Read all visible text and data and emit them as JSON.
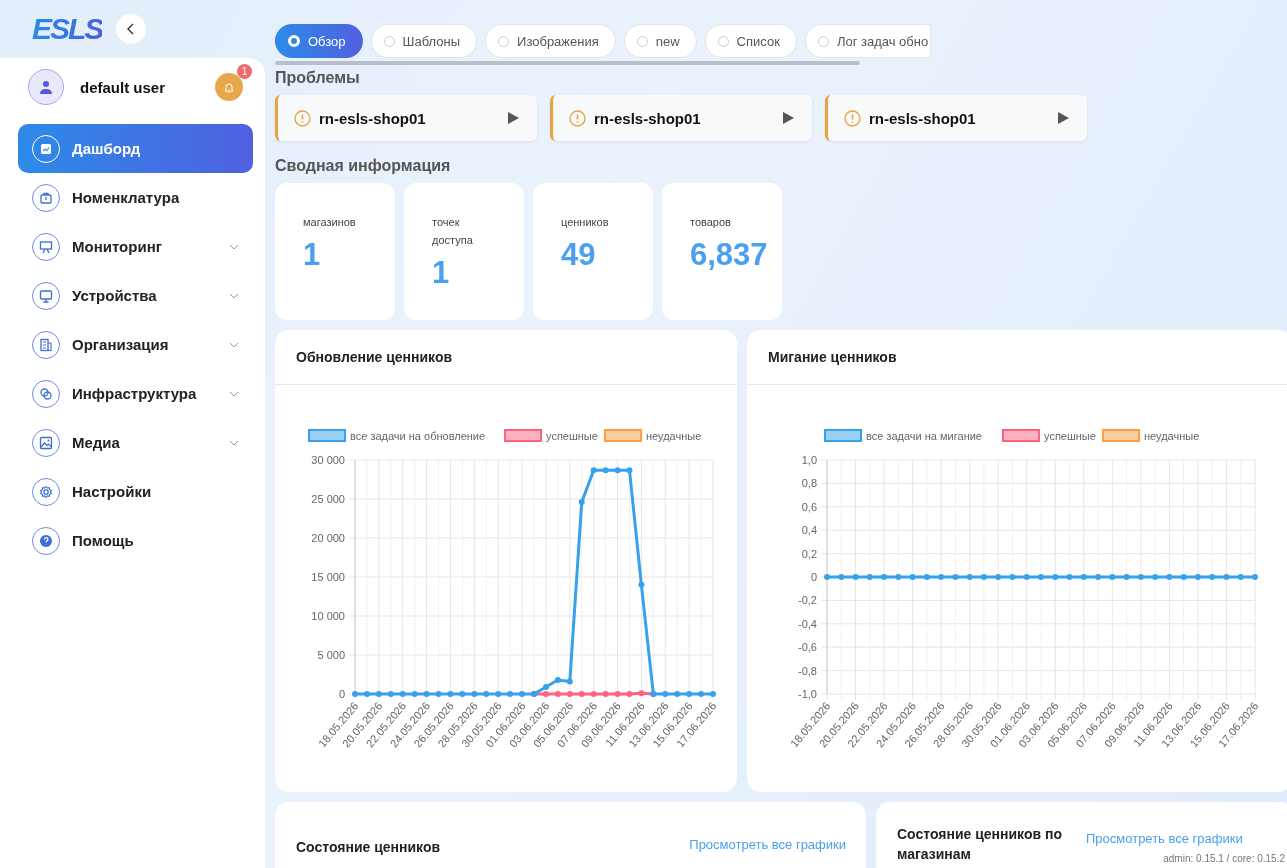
{
  "sidebar": {
    "logo": "ESLS",
    "user": {
      "name": "default user",
      "notifications": "1"
    },
    "items": [
      {
        "label": "Дашборд",
        "selected": true,
        "expandable": false
      },
      {
        "label": "Номенклатура",
        "selected": false,
        "expandable": false
      },
      {
        "label": "Мониторинг",
        "selected": false,
        "expandable": true
      },
      {
        "label": "Устройства",
        "selected": false,
        "expandable": true
      },
      {
        "label": "Организация",
        "selected": false,
        "expandable": true
      },
      {
        "label": "Инфраструктура",
        "selected": false,
        "expandable": true
      },
      {
        "label": "Медиа",
        "selected": false,
        "expandable": true
      },
      {
        "label": "Настройки",
        "selected": false,
        "expandable": false
      },
      {
        "label": "Помощь",
        "selected": false,
        "expandable": false
      }
    ]
  },
  "tabs": [
    {
      "label": "Обзор",
      "selected": true
    },
    {
      "label": "Шаблоны",
      "selected": false
    },
    {
      "label": "Изображения",
      "selected": false
    },
    {
      "label": "new",
      "selected": false
    },
    {
      "label": "Список",
      "selected": false
    },
    {
      "label": "Лог задач обно",
      "selected": false
    }
  ],
  "problems": {
    "title": "Проблемы",
    "items": [
      {
        "name": "rn-esls-shop01"
      },
      {
        "name": "rn-esls-shop01"
      },
      {
        "name": "rn-esls-shop01"
      }
    ]
  },
  "summary": {
    "title": "Сводная информация",
    "stats": [
      {
        "label": "магазинов",
        "value": "1"
      },
      {
        "label": "точек доступа",
        "value": "1"
      },
      {
        "label": "ценников",
        "value": "49"
      },
      {
        "label": "товаров",
        "value": "6,837"
      }
    ]
  },
  "charts": [
    {
      "title": "Обновление ценников",
      "chart_data": {
        "type": "line",
        "categories": [
          "18.05.2026",
          null,
          "20.05.2026",
          null,
          "22.05.2026",
          null,
          "24.05.2026",
          null,
          "26.05.2026",
          null,
          "28.05.2026",
          null,
          "30.05.2026",
          null,
          "01.06.2026",
          null,
          "03.06.2026",
          null,
          "05.06.2026",
          null,
          "07.06.2026",
          null,
          "09.06.2026",
          null,
          "11.06.2026",
          null,
          "13.06.2026",
          null,
          "15.06.2026",
          null,
          "17.06.2026"
        ],
        "grid": true,
        "legend": true,
        "series": [
          {
            "name": "все задачи на обновление",
            "color": "#36a2eb",
            "marker": "circle",
            "values": [
              0,
              0,
              0,
              0,
              0,
              0,
              0,
              0,
              0,
              0,
              0,
              0,
              0,
              0,
              0,
              0,
              900,
              1800,
              1600,
              24600,
              28700,
              28700,
              28700,
              28700,
              14000,
              0,
              0,
              0,
              0,
              0,
              0
            ]
          },
          {
            "name": "успешные",
            "color": "#ff6384",
            "marker": "circle",
            "values": [
              null,
              null,
              null,
              null,
              null,
              null,
              null,
              null,
              null,
              null,
              null,
              null,
              null,
              null,
              null,
              0,
              0,
              0,
              0,
              0,
              0,
              0,
              0,
              0,
              100,
              0,
              null,
              null,
              null,
              null,
              null
            ]
          },
          {
            "name": "неудачные",
            "color": "#ff9f40",
            "values": [
              null,
              null,
              null,
              null,
              null,
              null,
              null,
              null,
              null,
              null,
              null,
              null,
              null,
              null,
              null,
              null,
              null,
              null,
              null,
              null,
              null,
              null,
              null,
              null,
              null,
              null,
              null,
              null,
              null,
              null,
              null
            ]
          }
        ],
        "ylim": [
          0,
          30000
        ],
        "yticks": [
          {
            "value": 0,
            "label": "0"
          },
          {
            "value": 5000,
            "label": "5 000"
          },
          {
            "value": 10000,
            "label": "10 000"
          },
          {
            "value": 15000,
            "label": "15 000"
          },
          {
            "value": 20000,
            "label": "20 000"
          },
          {
            "value": 25000,
            "label": "25 000"
          },
          {
            "value": 30000,
            "label": "30 000"
          }
        ]
      }
    },
    {
      "title": "Мигание ценников",
      "chart_data": {
        "type": "line",
        "categories": [
          "18.05.2026",
          null,
          "20.05.2026",
          null,
          "22.05.2026",
          null,
          "24.05.2026",
          null,
          "26.05.2026",
          null,
          "28.05.2026",
          null,
          "30.05.2026",
          null,
          "01.06.2026",
          null,
          "03.06.2026",
          null,
          "05.06.2026",
          null,
          "07.06.2026",
          null,
          "09.06.2026",
          null,
          "11.06.2026",
          null,
          "13.06.2026",
          null,
          "15.06.2026",
          null,
          "17.06.2026"
        ],
        "grid": true,
        "legend": true,
        "series": [
          {
            "name": "все задачи на мигание",
            "color": "#36a2eb",
            "marker": "circle",
            "values": [
              0,
              0,
              0,
              0,
              0,
              0,
              0,
              0,
              0,
              0,
              0,
              0,
              0,
              0,
              0,
              0,
              0,
              0,
              0,
              0,
              0,
              0,
              0,
              0,
              0,
              0,
              0,
              0,
              0,
              0,
              0
            ]
          },
          {
            "name": "успешные",
            "color": "#ff6384",
            "values": [
              null,
              null,
              null,
              null,
              null,
              null,
              null,
              null,
              null,
              null,
              null,
              null,
              null,
              null,
              null,
              null,
              null,
              null,
              null,
              null,
              null,
              null,
              null,
              null,
              null,
              null,
              null,
              null,
              null,
              null,
              null
            ]
          },
          {
            "name": "неудачные",
            "color": "#ff9f40",
            "values": [
              null,
              null,
              null,
              null,
              null,
              null,
              null,
              null,
              null,
              null,
              null,
              null,
              null,
              null,
              null,
              null,
              null,
              null,
              null,
              null,
              null,
              null,
              null,
              null,
              null,
              null,
              null,
              null,
              null,
              null,
              null
            ]
          }
        ],
        "ylim": [
          -1,
          1
        ],
        "yticks": [
          {
            "value": -1,
            "label": "-1,0"
          },
          {
            "value": -0.8,
            "label": "-0,8"
          },
          {
            "value": -0.6,
            "label": "-0,6"
          },
          {
            "value": -0.4,
            "label": "-0,4"
          },
          {
            "value": -0.2,
            "label": "-0,2"
          },
          {
            "value": 0,
            "label": "0"
          },
          {
            "value": 0.2,
            "label": "0,2"
          },
          {
            "value": 0.4,
            "label": "0,4"
          },
          {
            "value": 0.6,
            "label": "0,6"
          },
          {
            "value": 0.8,
            "label": "0,8"
          },
          {
            "value": 1,
            "label": "1,0"
          }
        ]
      }
    }
  ],
  "status_cards": [
    {
      "title": "Состояние ценников",
      "link": "Просмотреть все графики"
    },
    {
      "title": "Состояние ценников по магазинам",
      "link": "Просмотреть все графики"
    }
  ],
  "version": "admin: 0.15.1 / core: 0.15.2"
}
